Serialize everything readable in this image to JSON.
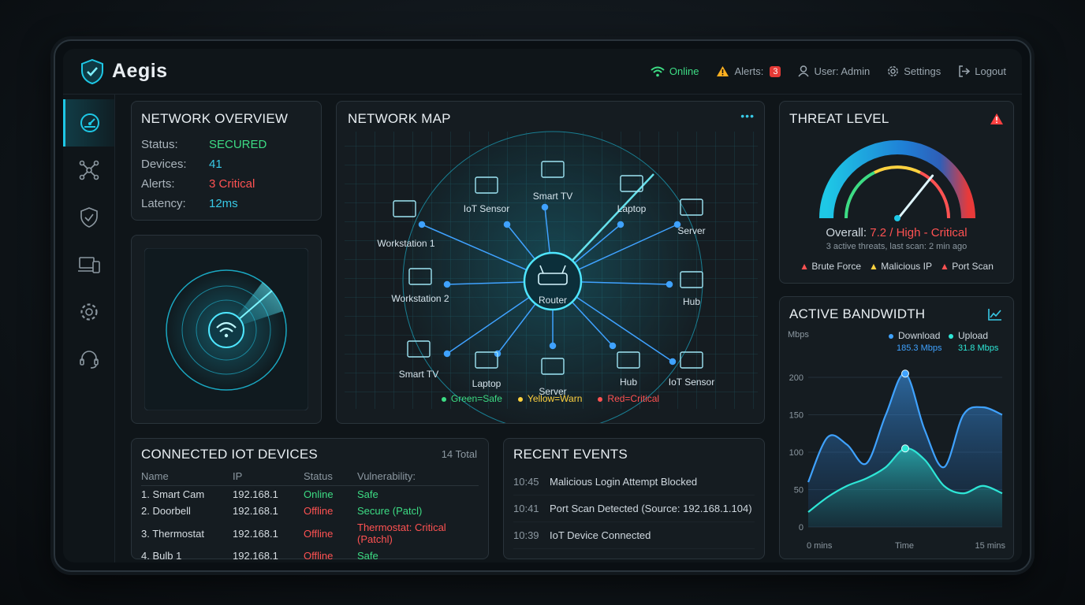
{
  "app": {
    "name": "Aegis"
  },
  "topbar": {
    "status": "Online",
    "alerts_label": "Alerts:",
    "alerts_count": "3",
    "user": "User: Admin",
    "settings": "Settings",
    "logout": "Logout"
  },
  "sidebar": {
    "items": [
      {
        "icon": "dashboard-gauge-icon"
      },
      {
        "icon": "network-topology-icon"
      },
      {
        "icon": "shield-check-icon"
      },
      {
        "icon": "devices-icon"
      },
      {
        "icon": "gear-icon"
      },
      {
        "icon": "headset-support-icon"
      }
    ]
  },
  "overview": {
    "title": "NETWORK OVERVIEW",
    "rows": [
      {
        "label": "Status:",
        "value": "SECURED"
      },
      {
        "label": "Devices:",
        "value": "41"
      },
      {
        "label": "Alerts:",
        "value": "3 Critical"
      },
      {
        "label": "Latency:",
        "value": "12ms"
      }
    ]
  },
  "network_map": {
    "title": "NETWORK MAP",
    "menu": "•••",
    "center": "Router",
    "nodes": [
      "Workstation 1",
      "IoT Sensor",
      "Smart TV",
      "Laptop",
      "Server",
      "Workstation 2",
      "Hub",
      "Smart TV",
      "Laptop",
      "Server",
      "Hub",
      "IoT Sensor"
    ],
    "legend": [
      {
        "label": "Green=Safe",
        "color": "#3ddc84"
      },
      {
        "label": "Yellow=Warn",
        "color": "#ffd23f"
      },
      {
        "label": "Red=Critical",
        "color": "#ff5252"
      }
    ]
  },
  "threat": {
    "title": "THREAT LEVEL",
    "overall_label": "Overall:",
    "overall_value": "7.2 / High - Critical",
    "score": 7.2,
    "score_max": 10,
    "subtitle": "3 active threats, last scan: 2 min ago",
    "tags": [
      "Brute Force",
      "Malicious IP",
      "Port Scan"
    ]
  },
  "bandwidth": {
    "title": "ACTIVE BANDWIDTH",
    "unit": "Mbps",
    "download_label": "Download",
    "download_value": "185.3 Mbps",
    "upload_label": "Upload",
    "upload_value": "31.8 Mbps",
    "x_start": "0 mins",
    "x_mid": "Time",
    "x_end": "15 mins"
  },
  "chart_data": {
    "type": "area",
    "ylabel": "Mbps",
    "xlabel": "Time",
    "ylim": [
      0,
      200
    ],
    "yticks": [
      0,
      50,
      100,
      150,
      200
    ],
    "x": [
      0,
      1.5,
      3,
      4.5,
      6,
      7.5,
      9,
      10.5,
      12,
      13.5,
      15
    ],
    "series": [
      {
        "name": "Download",
        "color": "#3fa2ff",
        "values": [
          60,
          120,
          110,
          85,
          150,
          205,
          130,
          80,
          150,
          160,
          150
        ]
      },
      {
        "name": "Upload",
        "color": "#2ee6d6",
        "values": [
          20,
          40,
          55,
          65,
          80,
          105,
          90,
          55,
          45,
          55,
          45
        ]
      }
    ]
  },
  "iot": {
    "title": "CONNECTED IOT DEVICES",
    "total": "14 Total",
    "columns": [
      "Name",
      "IP",
      "Status",
      "Vulnerability:"
    ],
    "rows": [
      {
        "name": "1. Smart Cam",
        "ip": "192.168.1",
        "status": "Online",
        "vuln": "Safe",
        "status_color": "#3ddc84",
        "vuln_color": "#3ddc84"
      },
      {
        "name": "2. Doorbell",
        "ip": "192.168.1",
        "status": "Offline",
        "vuln": "Secure (Patcl)",
        "status_color": "#ff5252",
        "vuln_color": "#3ddc84"
      },
      {
        "name": "3. Thermostat",
        "ip": "192.168.1",
        "status": "Offline",
        "vuln": "Thermostat: Critical (Patchl)",
        "status_color": "#ff5252",
        "vuln_color": "#ff5252"
      },
      {
        "name": "4. Bulb 1",
        "ip": "192.168.1",
        "status": "Offline",
        "vuln": "Safe",
        "status_color": "#ff5252",
        "vuln_color": "#3ddc84"
      }
    ]
  },
  "events": {
    "title": "RECENT EVENTS",
    "rows": [
      {
        "time": "10:45",
        "text": "Malicious Login Attempt Blocked"
      },
      {
        "time": "10:41",
        "text": "Port Scan Detected (Source: 192.168.1.104)"
      },
      {
        "time": "10:39",
        "text": "IoT Device Connected"
      }
    ]
  }
}
